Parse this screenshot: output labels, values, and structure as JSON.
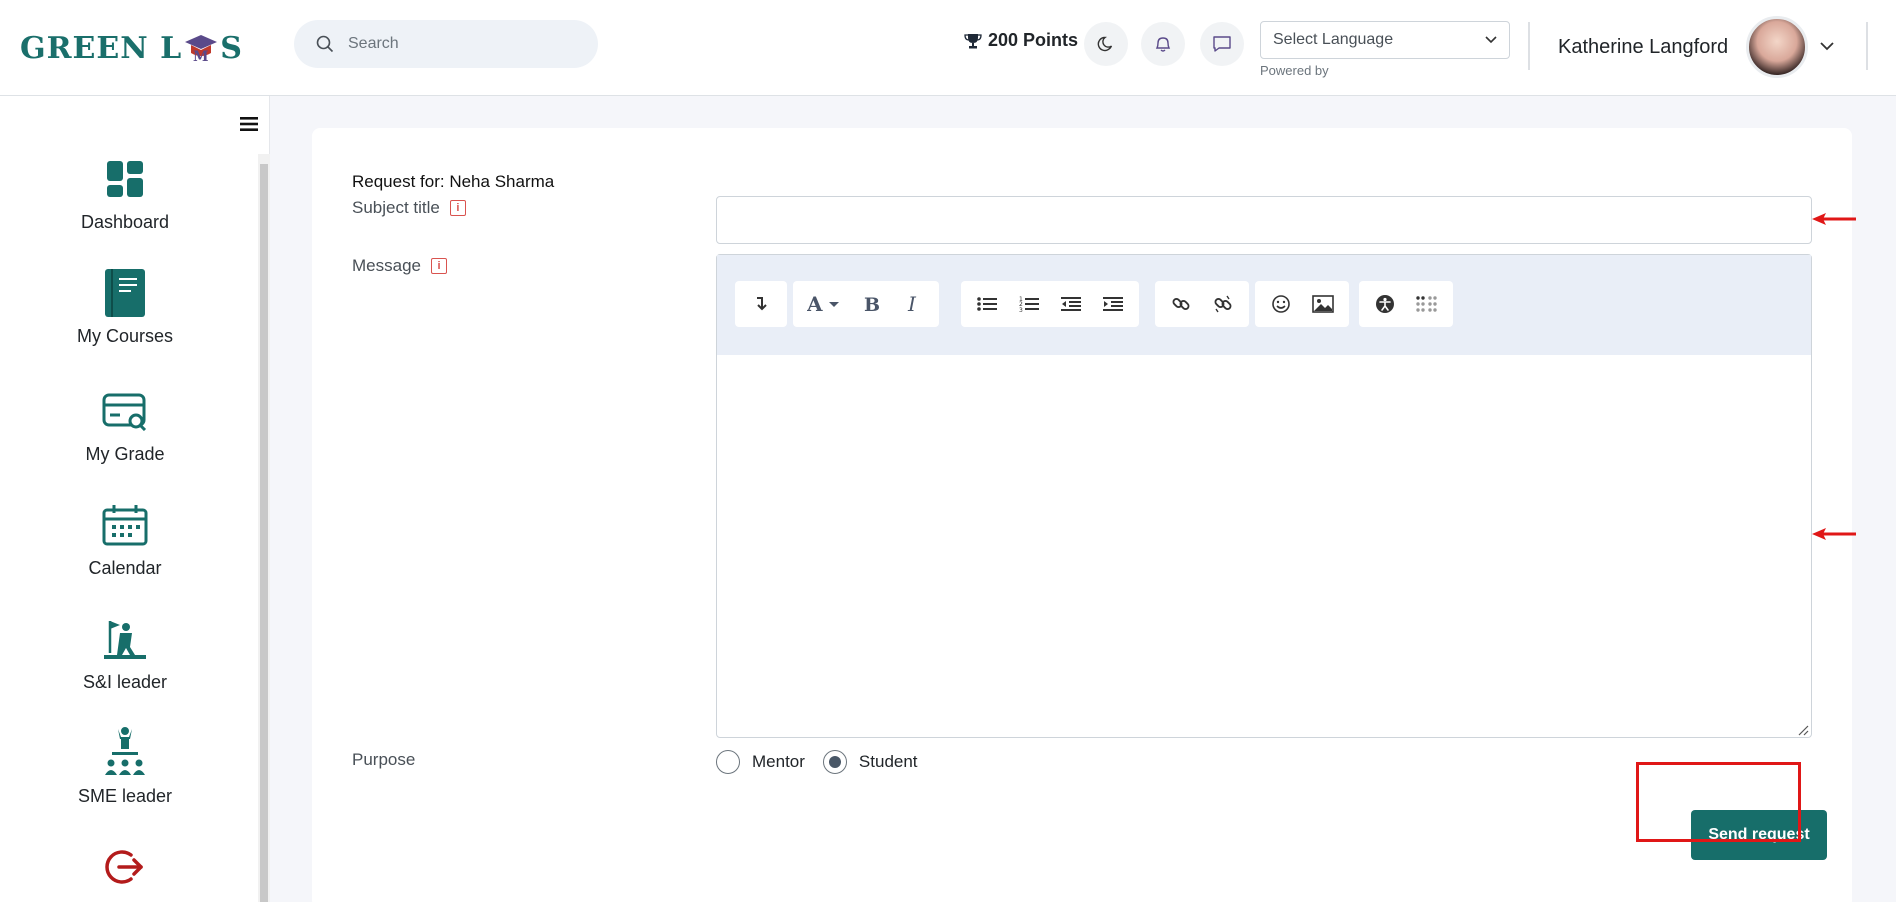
{
  "header": {
    "logo_text_left": "GREEN L",
    "logo_text_right": "S",
    "search_placeholder": "Search",
    "points": "200 Points",
    "language_select": "Select Language",
    "powered_by": "Powered by",
    "user_name": "Katherine Langford"
  },
  "sidebar": {
    "items": [
      {
        "label": "Dashboard",
        "icon": "dashboard-icon"
      },
      {
        "label": "My Courses",
        "icon": "book-icon"
      },
      {
        "label": "My Grade",
        "icon": "grade-card-icon"
      },
      {
        "label": "Calendar",
        "icon": "calendar-icon"
      },
      {
        "label": "S&I leader",
        "icon": "leader-flag-icon"
      },
      {
        "label": "SME leader",
        "icon": "team-leader-icon"
      },
      {
        "label": "",
        "icon": "logout-icon"
      }
    ]
  },
  "form": {
    "request_for": "Request for: Neha Sharma",
    "subject_label": "Subject title",
    "subject_value": "",
    "message_label": "Message",
    "purpose_label": "Purpose",
    "purpose_options": [
      {
        "label": "Mentor",
        "checked": false
      },
      {
        "label": "Student",
        "checked": true
      }
    ],
    "send_button": "Send request"
  },
  "colors": {
    "brand": "#176e6a",
    "annotation_red": "#e01717"
  }
}
